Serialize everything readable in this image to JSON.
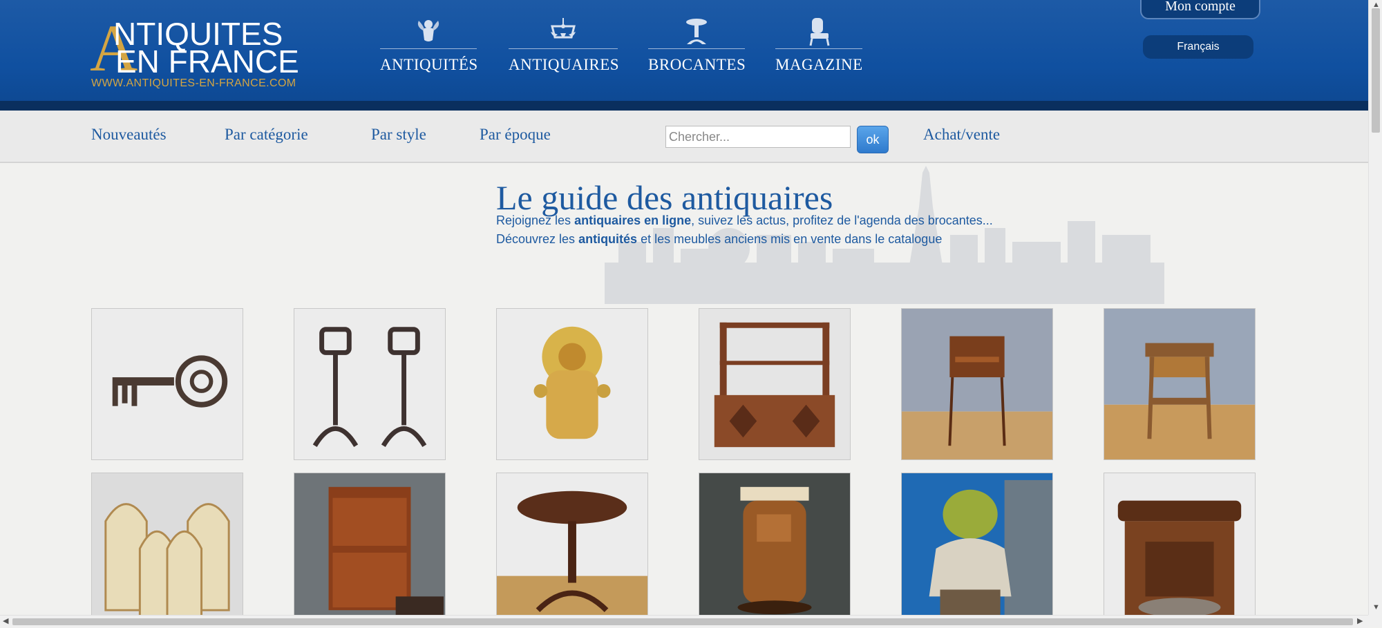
{
  "header": {
    "logo": {
      "initial": "A",
      "line1": "NTIQUITES",
      "line2": "EN FRANCE",
      "url": "WWW.ANTIQUITES-EN-FRANCE.COM"
    },
    "nav": [
      {
        "label": "ANTIQUITÉS",
        "icon": "cherub-icon"
      },
      {
        "label": "ANTIQUAIRES",
        "icon": "chandelier-icon"
      },
      {
        "label": "BROCANTES",
        "icon": "pedestal-table-icon"
      },
      {
        "label": "MAGAZINE",
        "icon": "armchair-icon"
      }
    ],
    "account_label": "Mon compte",
    "language_label": "Français"
  },
  "subnav": {
    "links": [
      "Nouveautés",
      "Par catégorie",
      "Par style",
      "Par époque"
    ],
    "search_placeholder": "Chercher...",
    "search_button": "ok",
    "buy_sell": "Achat/vente"
  },
  "guide": {
    "title": "Le guide des antiquaires",
    "line1_pre": "Rejoignez les ",
    "line1_bold": "antiquaires en ligne",
    "line1_post": ", suivez les actus, profitez de l'agenda des brocantes...",
    "line2_pre": "Découvrez les ",
    "line2_bold": "antiquités",
    "line2_post": " et les meubles anciens mis en vente dans le catalogue"
  },
  "products": [
    {
      "name": "antique-iron-key"
    },
    {
      "name": "wrought-iron-andirons"
    },
    {
      "name": "gilded-bronze-ornament"
    },
    {
      "name": "wall-shelf-cabinet"
    },
    {
      "name": "side-table-with-drawers"
    },
    {
      "name": "marquetry-side-table"
    },
    {
      "name": "gothic-chairs-set"
    },
    {
      "name": "secretaire-desk"
    },
    {
      "name": "round-pedestal-table"
    },
    {
      "name": "art-deco-cabinet"
    },
    {
      "name": "shrek-statue"
    },
    {
      "name": "black-forest-carved-box"
    }
  ],
  "colors": {
    "header_blue": "#1050a0",
    "header_band": "#0a2f5e",
    "gold": "#d4a543",
    "link_blue": "#1e5aa0",
    "subnav_bg": "#eaeaea"
  }
}
